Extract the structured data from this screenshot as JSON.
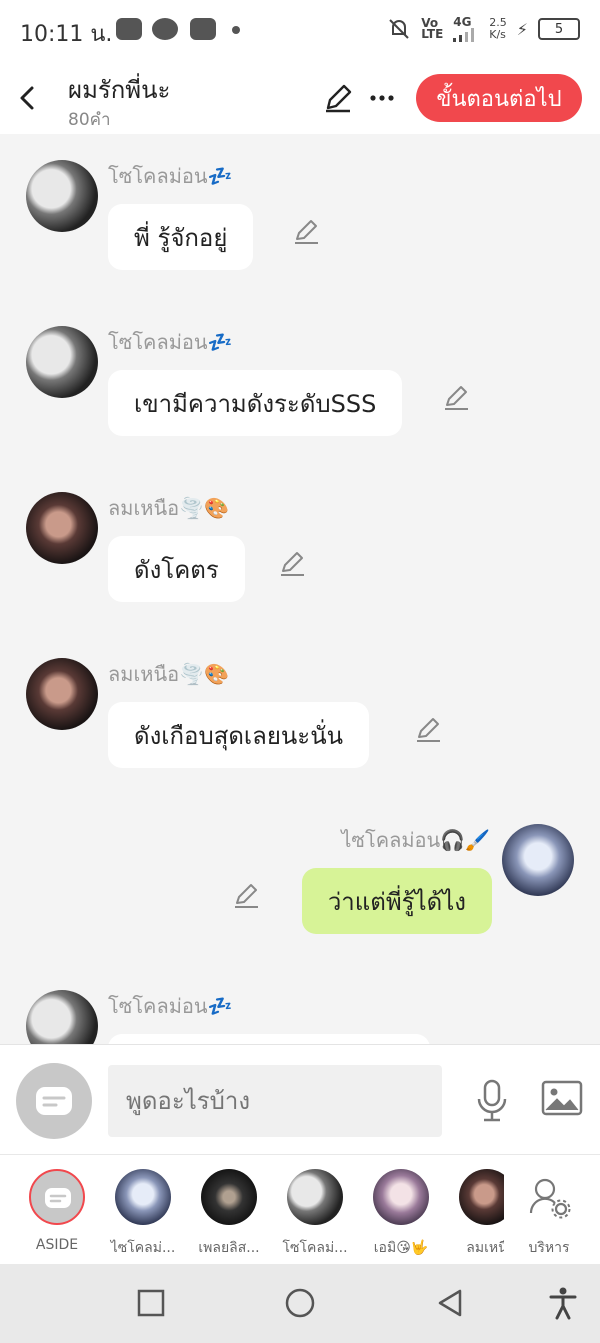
{
  "status_bar": {
    "time": "10:11 น.",
    "network_text": "4G",
    "speed_top": "2.5",
    "speed_bottom": "K/s",
    "volte_top": "Vo",
    "volte_bottom": "LTE",
    "battery": "5"
  },
  "header": {
    "title": "ผมรักพี่นะ",
    "word_count": "80คำ",
    "next_button": "ขั้นตอนต่อไป"
  },
  "messages": [
    {
      "sender": "โซโคลม่อน💤",
      "text": "พี่ รู้จักอยู่",
      "mine": false
    },
    {
      "sender": "โซโคลม่อน💤",
      "text": "เขามีความดังระดับSSS",
      "mine": false
    },
    {
      "sender": "ลมเหนือ🌪️🎨",
      "text": "ดังโคตร",
      "mine": false
    },
    {
      "sender": "ลมเหนือ🌪️🎨",
      "text": "ดังเกือบสุดเลยนะนั่น",
      "mine": false
    },
    {
      "sender": "ไซโคลม่อน🎧🖌️",
      "text": "ว่าแต่พี่รู้ได้ไง",
      "mine": true
    },
    {
      "sender": "โซโคลม่อน💤",
      "text": "",
      "mine": false
    }
  ],
  "input": {
    "placeholder": "พูดอะไรบ้าง"
  },
  "members": [
    {
      "label": "ASIDE"
    },
    {
      "label": "ไซโคลม่..."
    },
    {
      "label": "เพลยลิส..."
    },
    {
      "label": "โซโคลม่..."
    },
    {
      "label": "เอมิ😘🤟"
    },
    {
      "label": "ลมเหนื"
    },
    {
      "label": "บริหาร"
    }
  ],
  "colors": {
    "accent": "#f1484d",
    "my_bubble": "#d7f397",
    "other_bubble": "#ffffff",
    "background": "#f4f4f4"
  },
  "icons": [
    "back-icon",
    "edit-icon",
    "more-icon",
    "pencil-icon",
    "aside-icon",
    "mic-icon",
    "image-icon",
    "manage-icon",
    "square-icon",
    "circle-icon",
    "triangle-icon",
    "accessibility-icon"
  ]
}
